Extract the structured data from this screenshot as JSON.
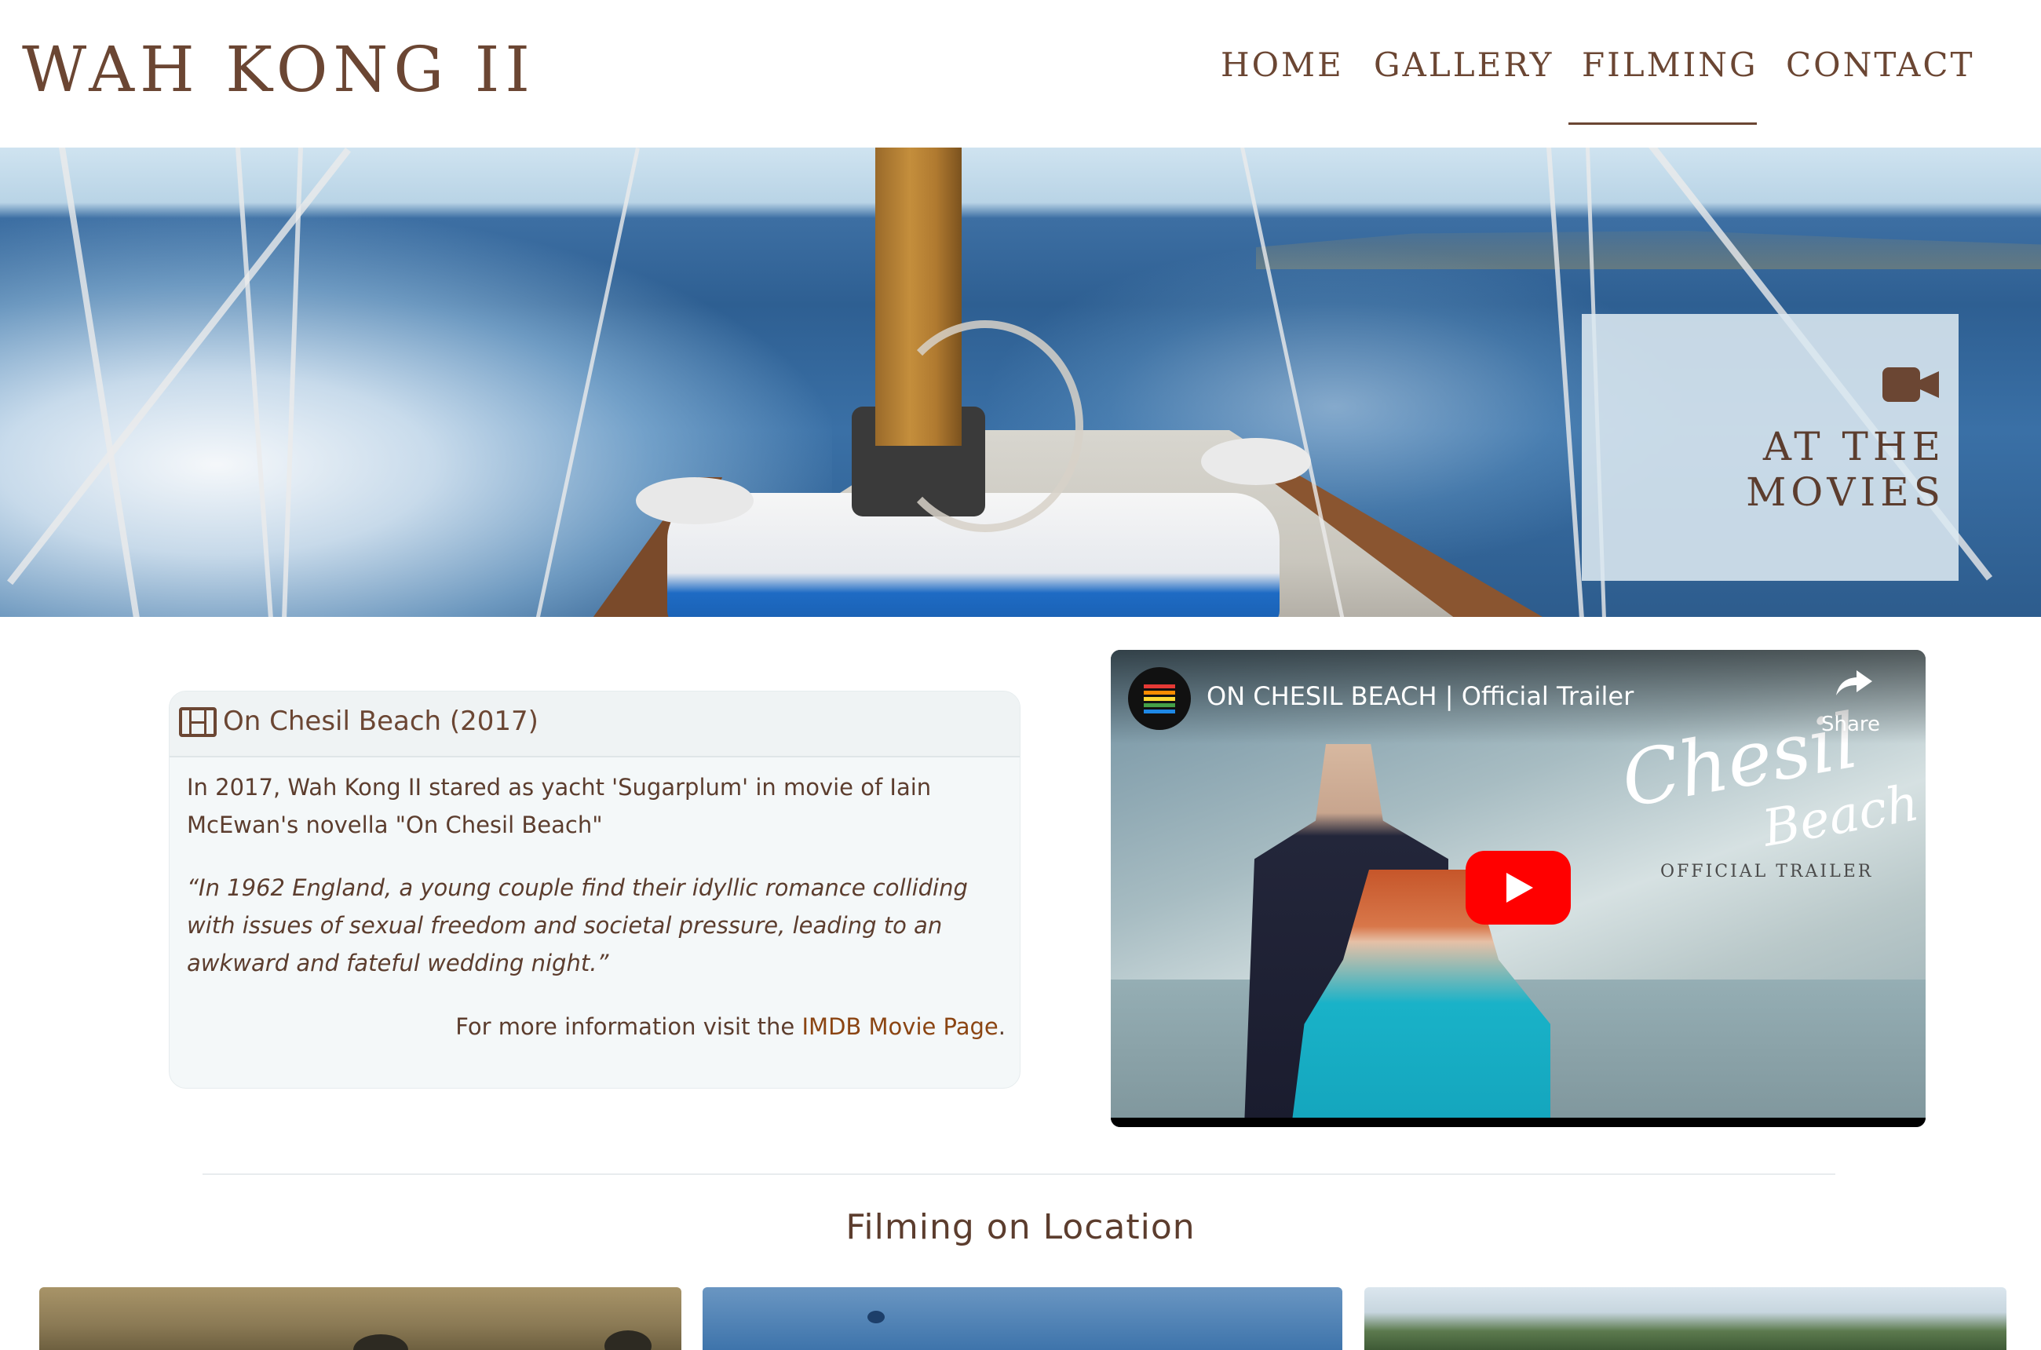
{
  "site": {
    "title": "WAH KONG II"
  },
  "nav": {
    "items": [
      {
        "label": "HOME",
        "active": false
      },
      {
        "label": "GALLERY",
        "active": false
      },
      {
        "label": "FILMING",
        "active": true
      },
      {
        "label": "CONTACT",
        "active": false
      }
    ]
  },
  "hero": {
    "overlay_icon": "video-camera-icon",
    "overlay_line1": "AT THE",
    "overlay_line2": "MOVIES"
  },
  "movie_card": {
    "icon": "film-icon",
    "title": "On Chesil Beach (2017)",
    "description": "In 2017, Wah Kong II stared as yacht 'Sugarplum' in movie of Iain McEwan's novella \"On Chesil Beach\"",
    "quote": "“In 1962 England, a young couple find their idyllic romance colliding with issues of sexual freedom and societal pressure, leading to an awkward and fateful wedding night.”",
    "more_info_prefix": "For more information visit the ",
    "more_info_link": "IMDB Movie Page",
    "more_info_suffix": "."
  },
  "video": {
    "title": "ON CHESIL BEACH | Official Trailer",
    "share_label": "Share",
    "poster_title_line1": "Chesil",
    "poster_title_line2": "Beach",
    "poster_subtitle": "OFFICIAL TRAILER",
    "play_icon": "play-icon",
    "share_icon": "share-icon"
  },
  "section": {
    "title": "Filming on Location"
  },
  "colors": {
    "text_brown": "#6b4633",
    "link_brown": "#8b4513",
    "youtube_red": "#ff0000",
    "card_bg": "#f4f8f9"
  }
}
